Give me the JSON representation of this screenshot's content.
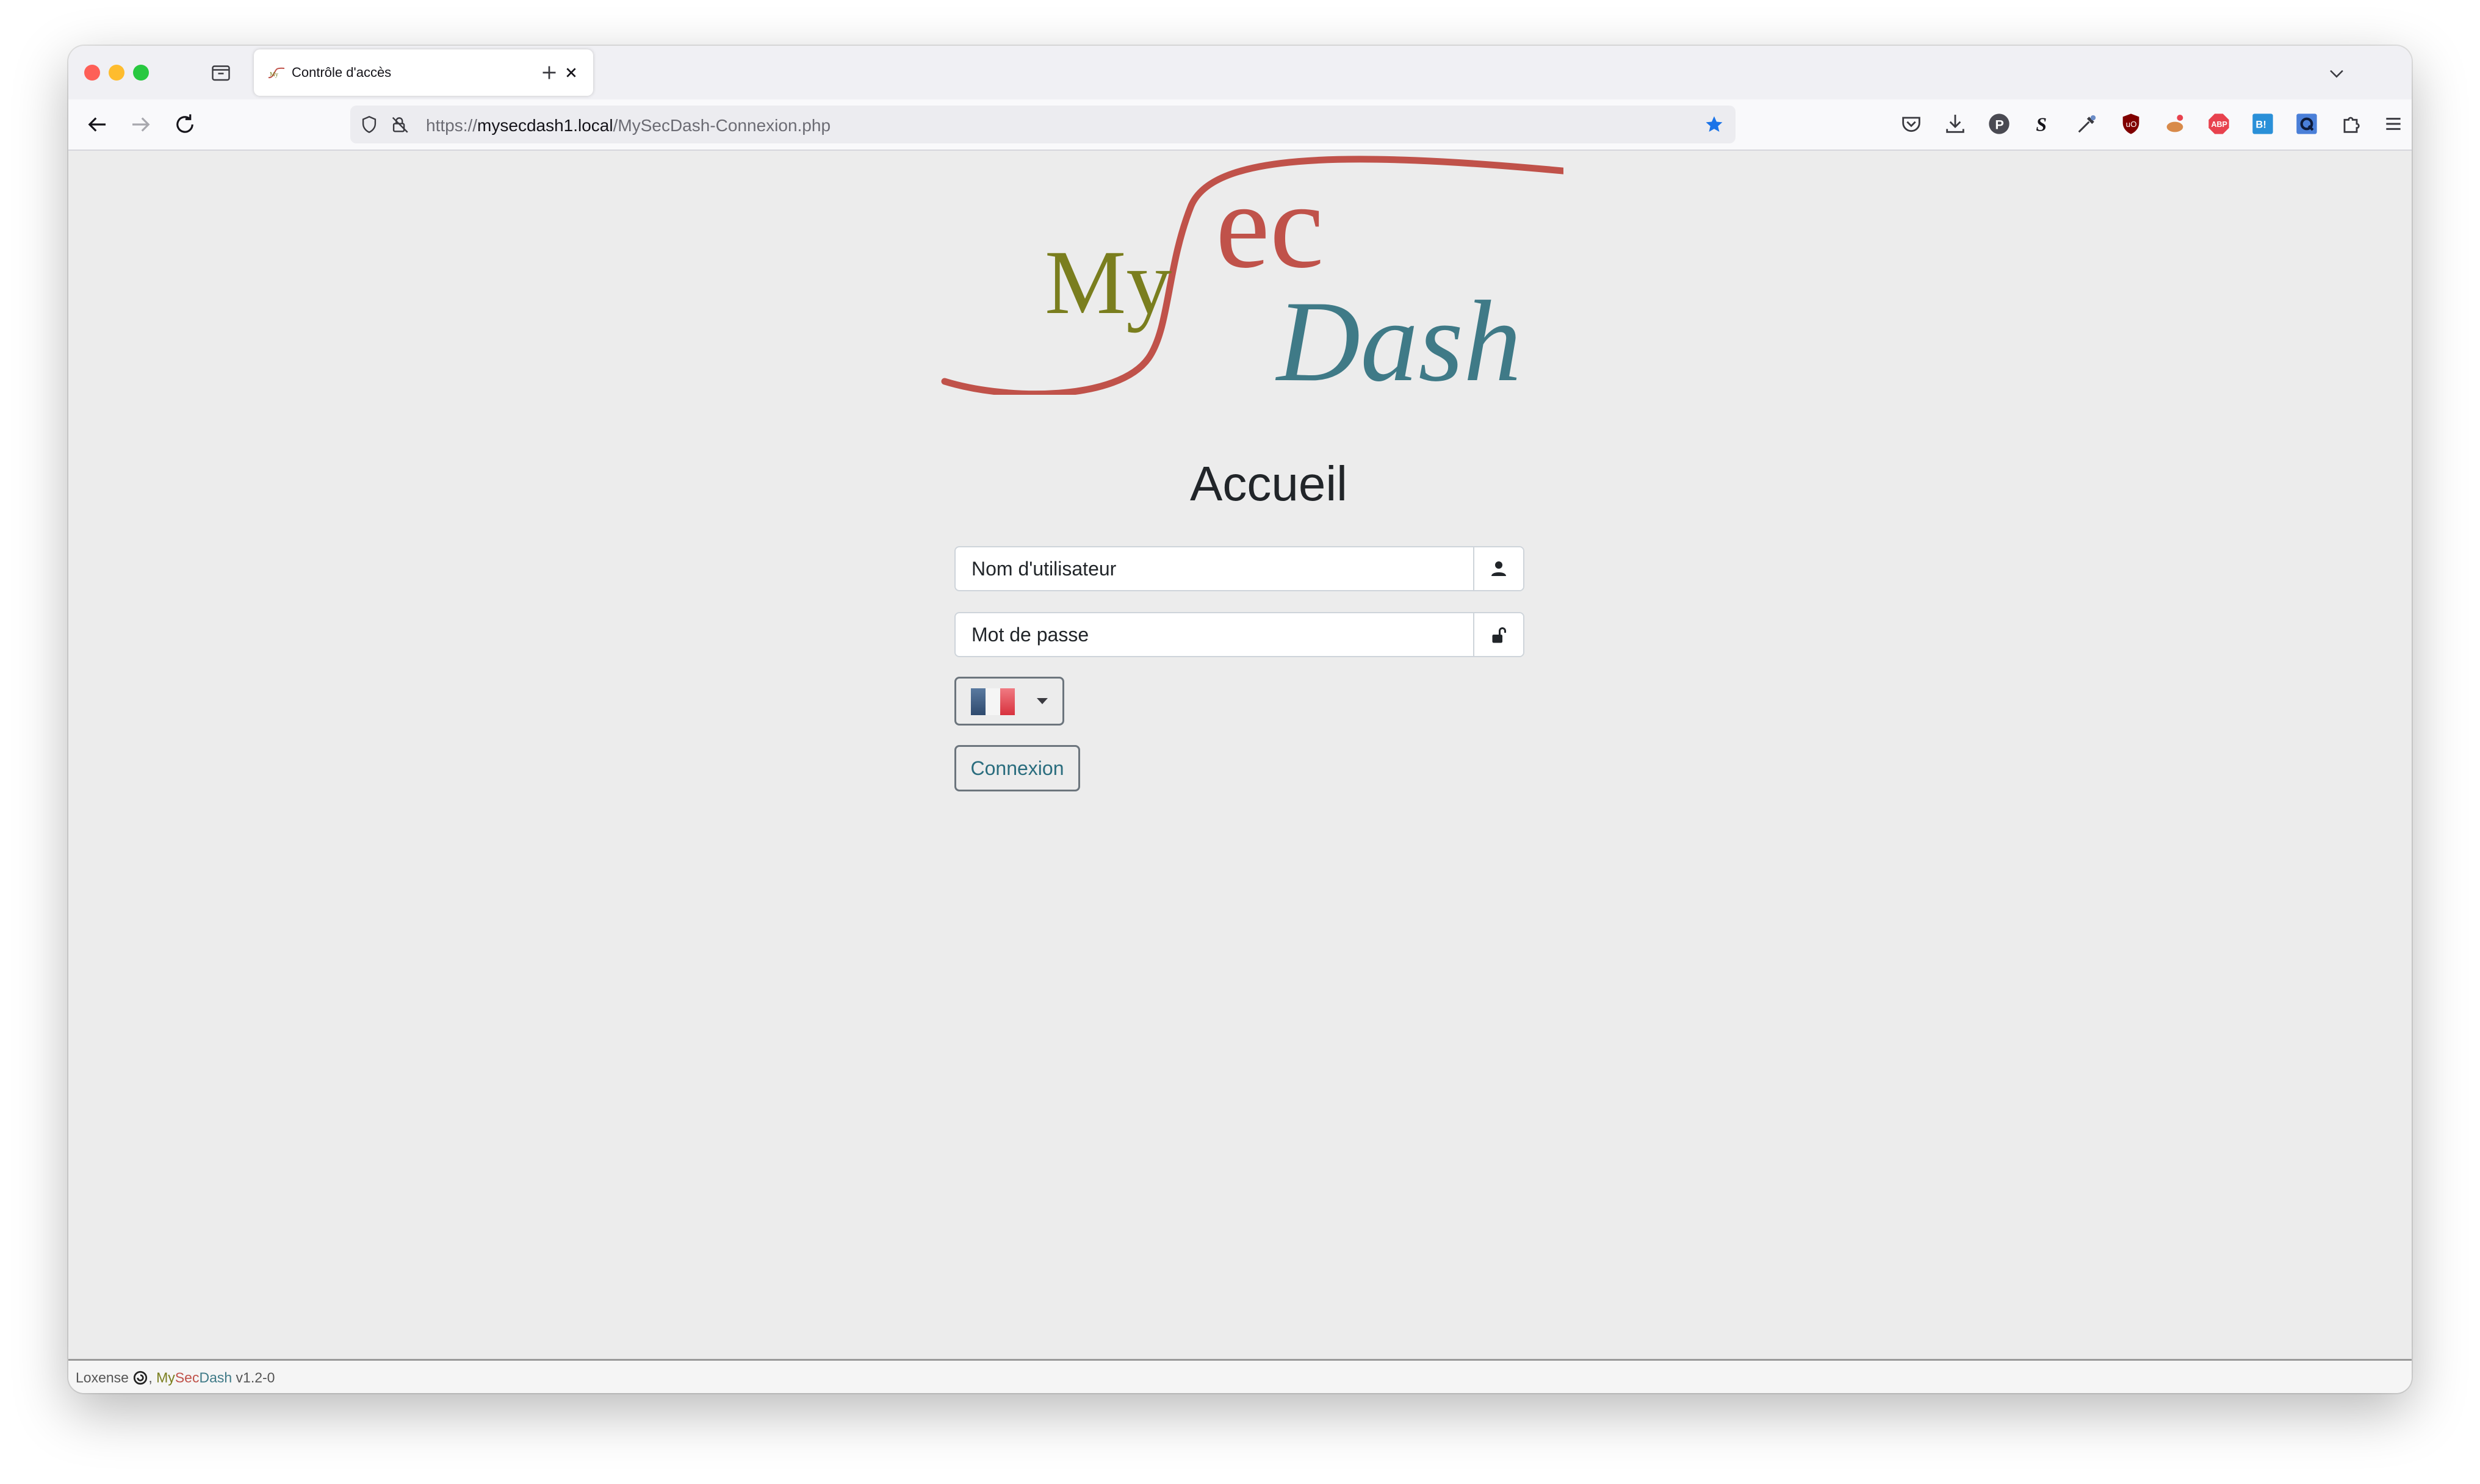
{
  "browser": {
    "tab": {
      "title": "Contrôle d'accès"
    },
    "url": {
      "scheme": "https://",
      "host": "mysecdash1.local",
      "path": "/MySecDash-Connexion.php"
    }
  },
  "page": {
    "logo": {
      "part_my": "My",
      "part_sec": "ec",
      "part_dash": "Dash"
    },
    "title": "Accueil",
    "username": {
      "placeholder": "Nom d'utilisateur",
      "value": ""
    },
    "password": {
      "placeholder": "Mot de passe",
      "value": ""
    },
    "language": {
      "selected": "French",
      "flag_colors": [
        "#3a5a80",
        "#ffffff",
        "#e8424e"
      ]
    },
    "login_label": "Connexion"
  },
  "footer": {
    "company": "Loxense",
    "app_my": "My",
    "app_sec": "Sec",
    "app_dash": "Dash",
    "version": "v1.2-0"
  },
  "colors": {
    "logo_my": "#7a7e1e",
    "logo_sec": "#c0524a",
    "logo_dash": "#3f7a87",
    "accent_star": "#1a73e8"
  }
}
